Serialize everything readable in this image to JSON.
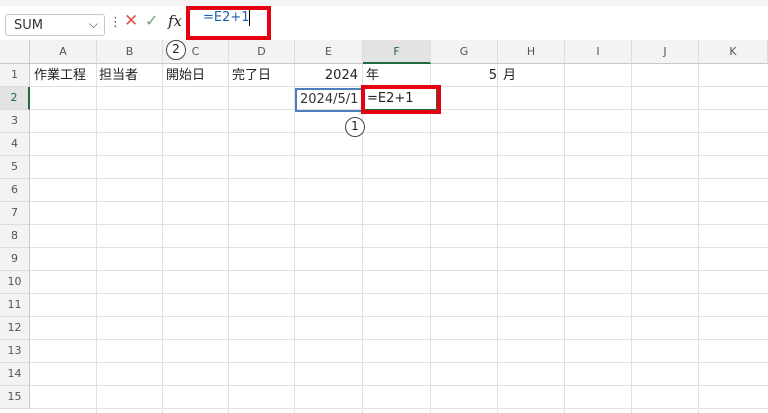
{
  "formula_bar": {
    "name_box": "SUM",
    "name_box_arrow": "⌵",
    "separator": "⋮",
    "cancel_symbol": "✕",
    "enter_symbol": "✓",
    "fx_label": "fx",
    "formula_text": "=E2+1"
  },
  "columns": [
    "A",
    "B",
    "C",
    "D",
    "E",
    "F",
    "G",
    "H",
    "I",
    "J",
    "K"
  ],
  "rows": [
    "1",
    "2",
    "3",
    "4",
    "5",
    "6",
    "7",
    "8",
    "9",
    "10",
    "11",
    "12",
    "13",
    "14",
    "15"
  ],
  "cells": {
    "A1": "作業工程",
    "B1": "担当者",
    "C1": "開始日",
    "D1": "完了日",
    "E1": "2024",
    "F1": "年",
    "G1": "5",
    "H1": "月",
    "E2": "2024/5/1",
    "F2": "=E2+1"
  },
  "annotations": {
    "marker_1": "1",
    "marker_2": "2",
    "highlight_color": "#e60012"
  },
  "colors": {
    "accent_green": "#1e6b3c",
    "selection_blue": "#4f7fb8"
  }
}
